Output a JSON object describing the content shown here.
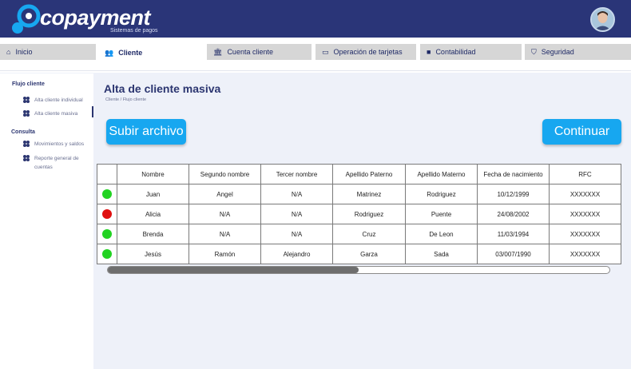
{
  "app": {
    "logo_text": "copayment",
    "logo_subtitle": "Sistemas de pagos"
  },
  "tabs": [
    {
      "label": "Inicio",
      "icon": "home-icon",
      "glyph": "⌂",
      "active": false
    },
    {
      "label": "Cliente",
      "icon": "users-icon",
      "glyph": "👥",
      "active": true
    },
    {
      "label": "Cuenta cliente",
      "icon": "bank-icon",
      "glyph": "🏛",
      "active": false
    },
    {
      "label": "Operación de tarjetas",
      "icon": "credit-card-icon",
      "glyph": "▭",
      "active": false
    },
    {
      "label": "Contabilidad",
      "icon": "ledger-icon",
      "glyph": "■",
      "active": false
    },
    {
      "label": "Seguridad",
      "icon": "shield-icon",
      "glyph": "⛉",
      "active": false
    }
  ],
  "sidebar": {
    "sections": [
      {
        "title": "Flujo cliente",
        "items": [
          {
            "label": "Alta cliente individual"
          },
          {
            "label": "Alta cliente masiva"
          }
        ]
      },
      {
        "title": "Consulta",
        "items": [
          {
            "label": "Movimientos y saldos"
          },
          {
            "label": "Reporte general de cuentas"
          }
        ]
      }
    ]
  },
  "main": {
    "title": "Alta de cliente masiva",
    "breadcrumb": "Cliente / Flujo cliente",
    "upload_label": "Subir archivo",
    "continue_label": "Continuar"
  },
  "table": {
    "headers": [
      "",
      "Nombre",
      "Segundo nombre",
      "Tercer nombre",
      "Apellido Paterno",
      "Apellido Materno",
      "Fecha de nacimiento",
      "RFC"
    ],
    "rows": [
      {
        "status": "ok",
        "status_color": "#22d322",
        "cells": [
          "Juan",
          "Angel",
          "N/A",
          "Matrinez",
          "Rodriguez",
          "10/12/1999",
          "XXXXXXX"
        ]
      },
      {
        "status": "error",
        "status_color": "#e01010",
        "cells": [
          "Alicia",
          "N/A",
          "N/A",
          "Rodriguez",
          "Puente",
          "24/08/2002",
          "XXXXXXX"
        ]
      },
      {
        "status": "ok",
        "status_color": "#22d322",
        "cells": [
          "Brenda",
          "N/A",
          "N/A",
          "Cruz",
          "De Leon",
          "11/03/1994",
          "XXXXXXX"
        ]
      },
      {
        "status": "ok",
        "status_color": "#22d322",
        "cells": [
          "Jesús",
          "Ramón",
          "Alejandro",
          "Garza",
          "Sada",
          "03/007/1990",
          "XXXXXXX"
        ]
      }
    ]
  },
  "scroll": {
    "thumb_fraction": 0.5
  },
  "colors": {
    "header": "#2a3578",
    "accent": "#17a7f0",
    "primary_text": "#2b3570"
  }
}
